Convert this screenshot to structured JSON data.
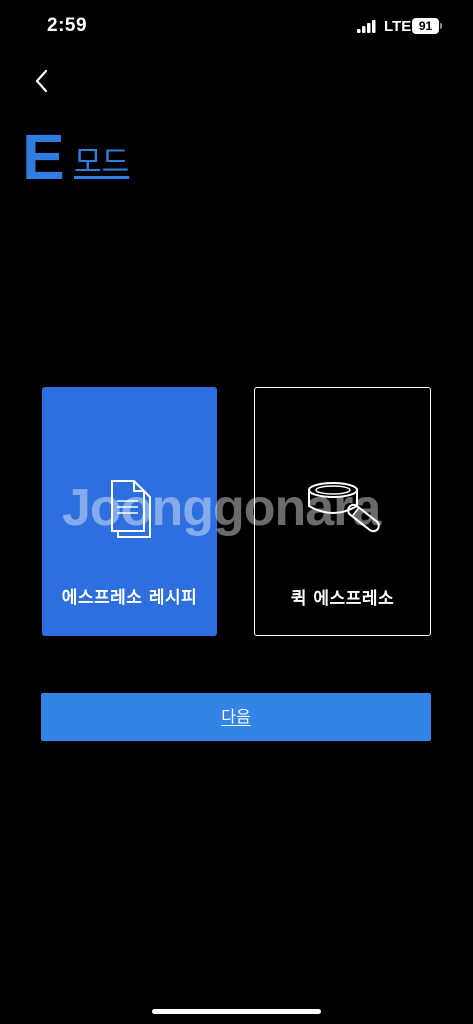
{
  "status_bar": {
    "time": "2:59",
    "network": "LTE",
    "battery": "91"
  },
  "header": {
    "back_icon": "chevron-left-icon",
    "mode_letter": "E",
    "mode_word": "모드"
  },
  "mode_cards": [
    {
      "label": "에스프레소 레시피",
      "icon": "document-stack-icon",
      "selected": true,
      "color": "#2d6fdf"
    },
    {
      "label": "퀵 에스프레소",
      "icon": "portafilter-icon",
      "selected": false
    }
  ],
  "watermark": "Joonggonara",
  "next_button": {
    "label": "다음",
    "color": "#3384e4"
  },
  "colors": {
    "accent": "#2f7de1",
    "background": "#000000"
  }
}
